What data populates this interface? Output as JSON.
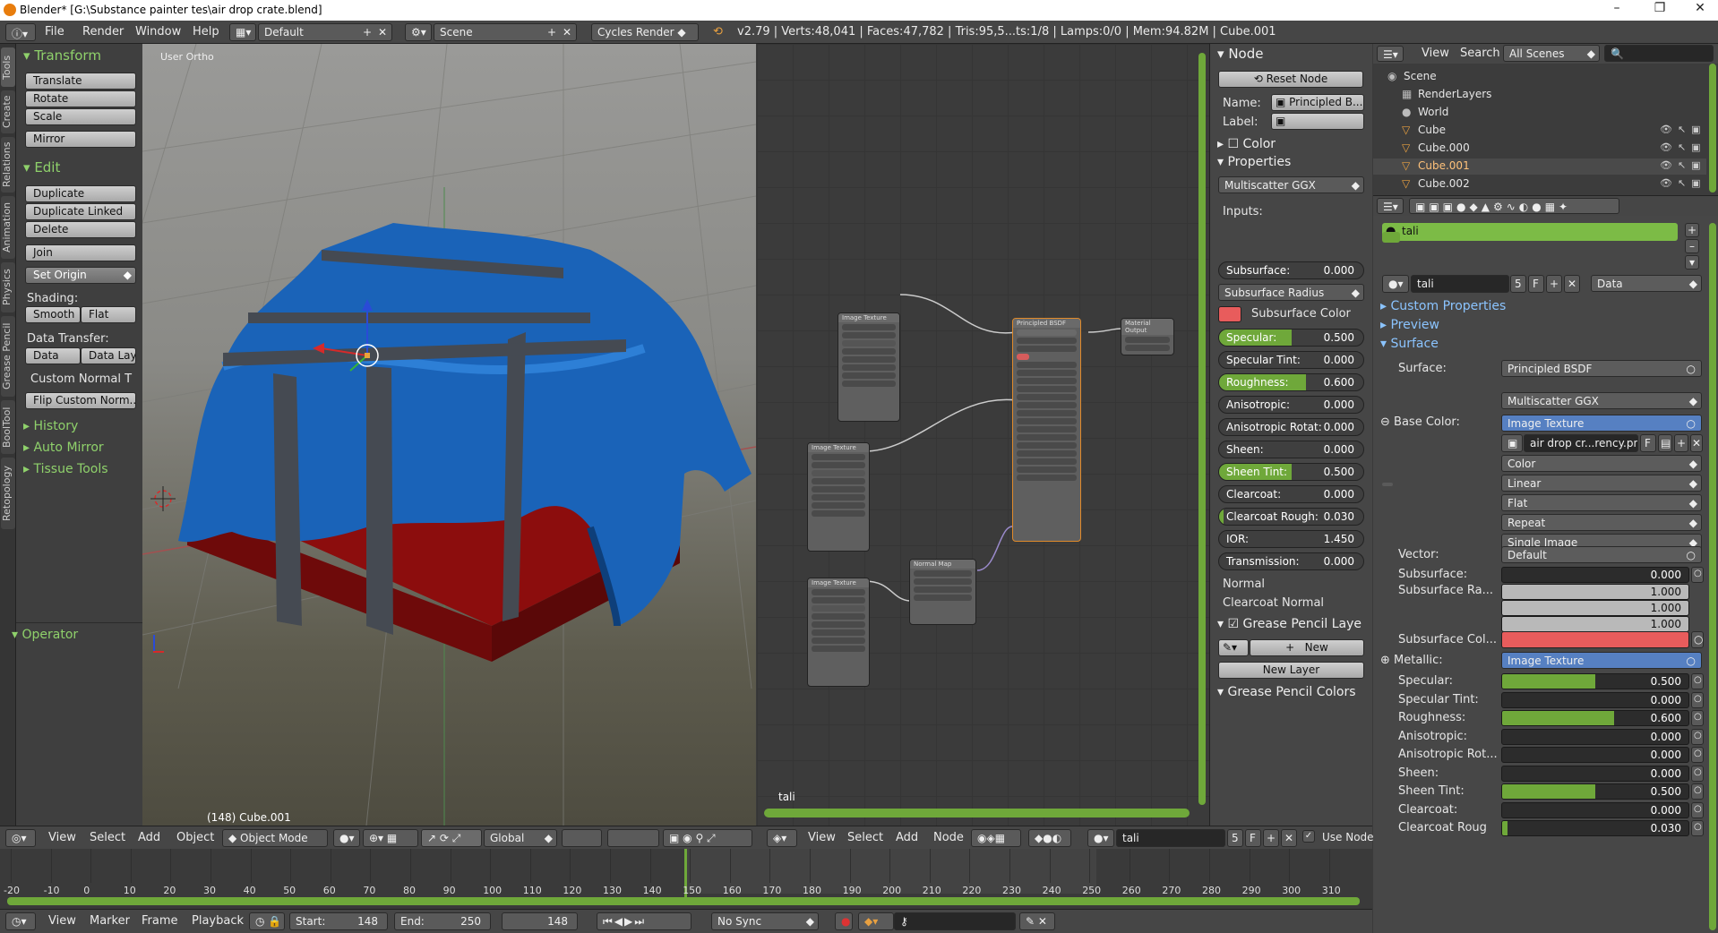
{
  "window": {
    "title": "Blender* [G:\\Substance painter tes\\air drop crate.blend]",
    "minimize": "–",
    "maximize": "❐",
    "close": "✕"
  },
  "info_header": {
    "menus": [
      "File",
      "Render",
      "Window",
      "Help"
    ],
    "layout": "Default",
    "scene": "Scene",
    "engine": "Cycles Render",
    "stats": "v2.79 | Verts:48,041 | Faces:47,782 | Tris:95,5...ts:1/8 | Lamps:0/0 | Mem:94.82M | Cube.001"
  },
  "toolshelf": {
    "tabs": [
      "Tools",
      "Create",
      "Relations",
      "Animation",
      "Physics",
      "Grease Pencil",
      "BoolTool",
      "Retopology"
    ],
    "transform_header": "Transform",
    "transform_buttons": [
      "Translate",
      "Rotate",
      "Scale",
      "Mirror"
    ],
    "edit_header": "Edit",
    "edit_buttons": [
      "Duplicate",
      "Duplicate Linked",
      "Delete",
      "Join"
    ],
    "set_origin": "Set Origin",
    "shading_label": "Shading:",
    "smooth": "Smooth",
    "flat": "Flat",
    "data_transfer_label": "Data Transfer:",
    "data": "Data",
    "data_lay": "Data Lay",
    "custom_normal": "Custom Normal T",
    "flip_custom": "Flip Custom Norm...",
    "history": "History",
    "auto_mirror": "Auto Mirror",
    "tissue_tools": "Tissue Tools",
    "operator": "Operator"
  },
  "viewport": {
    "view_label": "User Ortho",
    "object_info": "(148) Cube.001"
  },
  "node_editor": {
    "material_label": "tali"
  },
  "node_panel": {
    "node_header": "Node",
    "reset_node": "Reset Node",
    "name_label": "Name:",
    "name_value": "Principled B...",
    "label_label": "Label:",
    "color_header": "Color",
    "properties_header": "Properties",
    "distribution": "Multiscatter GGX",
    "inputs_label": "Inputs:",
    "subsurface_radius": "Subsurface Radius",
    "subsurface_color": "Subsurface Color",
    "inputs": [
      {
        "name": "Subsurface:",
        "value": "0.000",
        "frac": 0.0
      },
      {
        "name": "Specular:",
        "value": "0.500",
        "frac": 0.5
      },
      {
        "name": "Specular Tint:",
        "value": "0.000",
        "frac": 0.0
      },
      {
        "name": "Roughness:",
        "value": "0.600",
        "frac": 0.6
      },
      {
        "name": "Anisotropic:",
        "value": "0.000",
        "frac": 0.0
      },
      {
        "name": "Anisotropic Rotat:",
        "value": "0.000",
        "frac": 0.0
      },
      {
        "name": "Sheen:",
        "value": "0.000",
        "frac": 0.0
      },
      {
        "name": "Sheen Tint:",
        "value": "0.500",
        "frac": 0.5
      },
      {
        "name": "Clearcoat:",
        "value": "0.000",
        "frac": 0.0
      },
      {
        "name": "Clearcoat Rough:",
        "value": "0.030",
        "frac": 0.03
      },
      {
        "name": "IOR:",
        "value": "1.450",
        "frac": 0.0
      },
      {
        "name": "Transmission:",
        "value": "0.000",
        "frac": 0.0
      }
    ],
    "normal": "Normal",
    "clearcoat_normal": "Clearcoat Normal",
    "gp_layers": "Grease Pencil Laye",
    "new": "New",
    "new_layer": "New Layer",
    "gp_colors": "Grease Pencil Colors"
  },
  "outliner": {
    "view": "View",
    "search": "Search",
    "filter": "All Scenes",
    "items": [
      "Scene",
      "RenderLayers",
      "World",
      "Cube",
      "Cube.000",
      "Cube.001",
      "Cube.002"
    ]
  },
  "properties": {
    "material_slot": "tali",
    "material_name": "tali",
    "users": "5",
    "fake": "F",
    "link": "Data",
    "custom_properties": "Custom Properties",
    "preview": "Preview",
    "surface_header": "Surface",
    "surface_label": "Surface:",
    "surface_value": "Principled BSDF",
    "distribution": "Multiscatter GGX",
    "base_color_label": "Base Color:",
    "base_color_value": "Image Texture",
    "image_name": "air drop cr...rency.png",
    "tex_options": [
      "Color",
      "Linear",
      "Flat",
      "Repeat",
      "Single Image"
    ],
    "vector_label": "Vector:",
    "vector_value": "Default",
    "subsurface_radius_label": "Subsurface Ra...",
    "radius": [
      "1.000",
      "1.000",
      "1.000"
    ],
    "subsurface_color_label": "Subsurface Col...",
    "metallic_label": "Metallic:",
    "metallic_value": "Image Texture",
    "rows": [
      {
        "name": "Subsurface:",
        "value": "0.000",
        "frac": 0.0
      },
      {
        "name": "Specular:",
        "value": "0.500",
        "frac": 0.5
      },
      {
        "name": "Specular Tint:",
        "value": "0.000",
        "frac": 0.0
      },
      {
        "name": "Roughness:",
        "value": "0.600",
        "frac": 0.6
      },
      {
        "name": "Anisotropic:",
        "value": "0.000",
        "frac": 0.0
      },
      {
        "name": "Anisotropic Rot...",
        "value": "0.000",
        "frac": 0.0
      },
      {
        "name": "Sheen:",
        "value": "0.000",
        "frac": 0.0
      },
      {
        "name": "Sheen Tint:",
        "value": "0.500",
        "frac": 0.5
      },
      {
        "name": "Clearcoat:",
        "value": "0.000",
        "frac": 0.0
      },
      {
        "name": "Clearcoat Roug",
        "value": "0.030",
        "frac": 0.03
      }
    ]
  },
  "viewport_header": {
    "menus": [
      "View",
      "Select",
      "Add",
      "Object"
    ],
    "mode": "Object Mode",
    "orientation": "Global"
  },
  "node_header": {
    "menus": [
      "View",
      "Select",
      "Add",
      "Node"
    ],
    "material": "tali",
    "users": "5",
    "fake": "F",
    "use_nodes": "Use Node"
  },
  "timeline": {
    "ticks": [
      "-20",
      "-10",
      "0",
      "10",
      "20",
      "30",
      "40",
      "50",
      "60",
      "70",
      "80",
      "90",
      "100",
      "110",
      "120",
      "130",
      "140",
      "150",
      "160",
      "170",
      "180",
      "190",
      "200",
      "210",
      "220",
      "230",
      "240",
      "250",
      "260",
      "270",
      "280",
      "290",
      "300",
      "310"
    ],
    "menus": [
      "View",
      "Marker",
      "Frame",
      "Playback"
    ],
    "start_label": "Start:",
    "start": "148",
    "end_label": "End:",
    "end": "250",
    "current": "148",
    "sync": "No Sync"
  },
  "colors": {
    "accent_green": "#6fa83a",
    "header_green": "#8fd16b",
    "subsurface_color": "#e85c5c",
    "crate_red": "#8a0c0c",
    "cloth_blue": "#1a63b8"
  }
}
